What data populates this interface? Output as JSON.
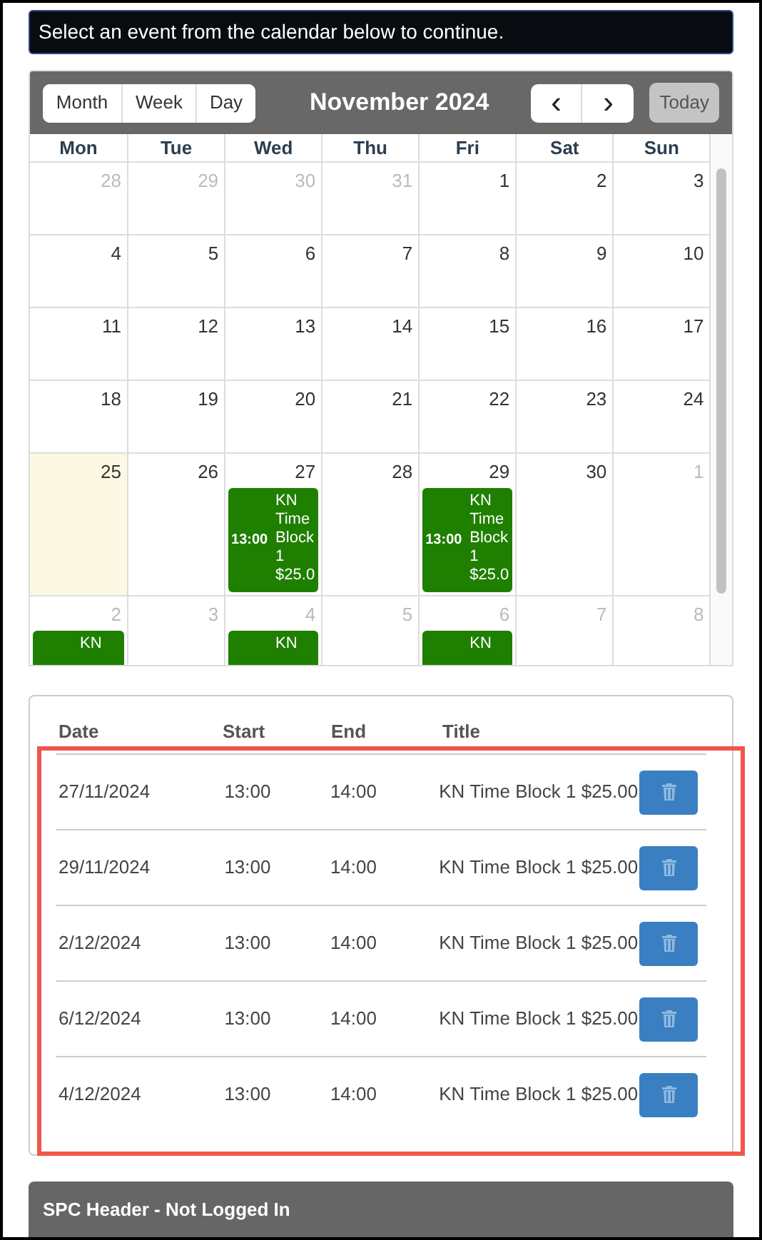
{
  "alert": {
    "text": "Select an event from the calendar below to continue."
  },
  "calendar": {
    "title": "November 2024",
    "views": [
      {
        "label": "Month",
        "selected": false
      },
      {
        "label": "Week",
        "selected": false
      },
      {
        "label": "Day",
        "selected": false
      }
    ],
    "prev": "‹",
    "next": "›",
    "today": {
      "label": "Today",
      "disabled": true
    },
    "weekdays": [
      "Mon",
      "Tue",
      "Wed",
      "Thu",
      "Fri",
      "Sat",
      "Sun"
    ],
    "weeks": [
      [
        {
          "day": "28",
          "other_month": true
        },
        {
          "day": "29",
          "other_month": true
        },
        {
          "day": "30",
          "other_month": true
        },
        {
          "day": "31",
          "other_month": true
        },
        {
          "day": "1",
          "other_month": false
        },
        {
          "day": "2",
          "other_month": false
        },
        {
          "day": "3",
          "other_month": false
        }
      ],
      [
        {
          "day": "4",
          "other_month": false
        },
        {
          "day": "5",
          "other_month": false
        },
        {
          "day": "6",
          "other_month": false
        },
        {
          "day": "7",
          "other_month": false
        },
        {
          "day": "8",
          "other_month": false
        },
        {
          "day": "9",
          "other_month": false
        },
        {
          "day": "10",
          "other_month": false
        }
      ],
      [
        {
          "day": "11",
          "other_month": false
        },
        {
          "day": "12",
          "other_month": false
        },
        {
          "day": "13",
          "other_month": false
        },
        {
          "day": "14",
          "other_month": false
        },
        {
          "day": "15",
          "other_month": false
        },
        {
          "day": "16",
          "other_month": false
        },
        {
          "day": "17",
          "other_month": false
        }
      ],
      [
        {
          "day": "18",
          "other_month": false
        },
        {
          "day": "19",
          "other_month": false
        },
        {
          "day": "20",
          "other_month": false
        },
        {
          "day": "21",
          "other_month": false
        },
        {
          "day": "22",
          "other_month": false
        },
        {
          "day": "23",
          "other_month": false
        },
        {
          "day": "24",
          "other_month": false
        }
      ],
      [
        {
          "day": "25",
          "other_month": false,
          "today": true
        },
        {
          "day": "26",
          "other_month": false
        },
        {
          "day": "27",
          "other_month": false,
          "events": [
            {
              "time": "13:00",
              "title": "KN Time Block 1 $25.0"
            }
          ]
        },
        {
          "day": "28",
          "other_month": false
        },
        {
          "day": "29",
          "other_month": false,
          "events": [
            {
              "time": "13:00",
              "title": "KN Time Block 1 $25.0"
            }
          ]
        },
        {
          "day": "30",
          "other_month": false
        },
        {
          "day": "1",
          "other_month": true
        }
      ],
      [
        {
          "day": "2",
          "other_month": true,
          "events": [
            {
              "title": "KN"
            }
          ]
        },
        {
          "day": "3",
          "other_month": true
        },
        {
          "day": "4",
          "other_month": true,
          "events": [
            {
              "title": "KN"
            }
          ]
        },
        {
          "day": "5",
          "other_month": true
        },
        {
          "day": "6",
          "other_month": true,
          "events": [
            {
              "title": "KN"
            }
          ]
        },
        {
          "day": "7",
          "other_month": true
        },
        {
          "day": "8",
          "other_month": true
        }
      ]
    ]
  },
  "bookings": {
    "columns": [
      "Date",
      "Start",
      "End",
      "Title"
    ],
    "rows": [
      {
        "date": "27/11/2024",
        "start": "13:00",
        "end": "14:00",
        "title": "KN Time Block 1 $25.00"
      },
      {
        "date": "29/11/2024",
        "start": "13:00",
        "end": "14:00",
        "title": "KN Time Block 1 $25.00"
      },
      {
        "date": "2/12/2024",
        "start": "13:00",
        "end": "14:00",
        "title": "KN Time Block 1 $25.00"
      },
      {
        "date": "6/12/2024",
        "start": "13:00",
        "end": "14:00",
        "title": "KN Time Block 1 $25.00"
      },
      {
        "date": "4/12/2024",
        "start": "13:00",
        "end": "14:00",
        "title": "KN Time Block 1 $25.00"
      }
    ]
  },
  "footer_panel": {
    "title": "SPC Header - Not Logged In"
  }
}
